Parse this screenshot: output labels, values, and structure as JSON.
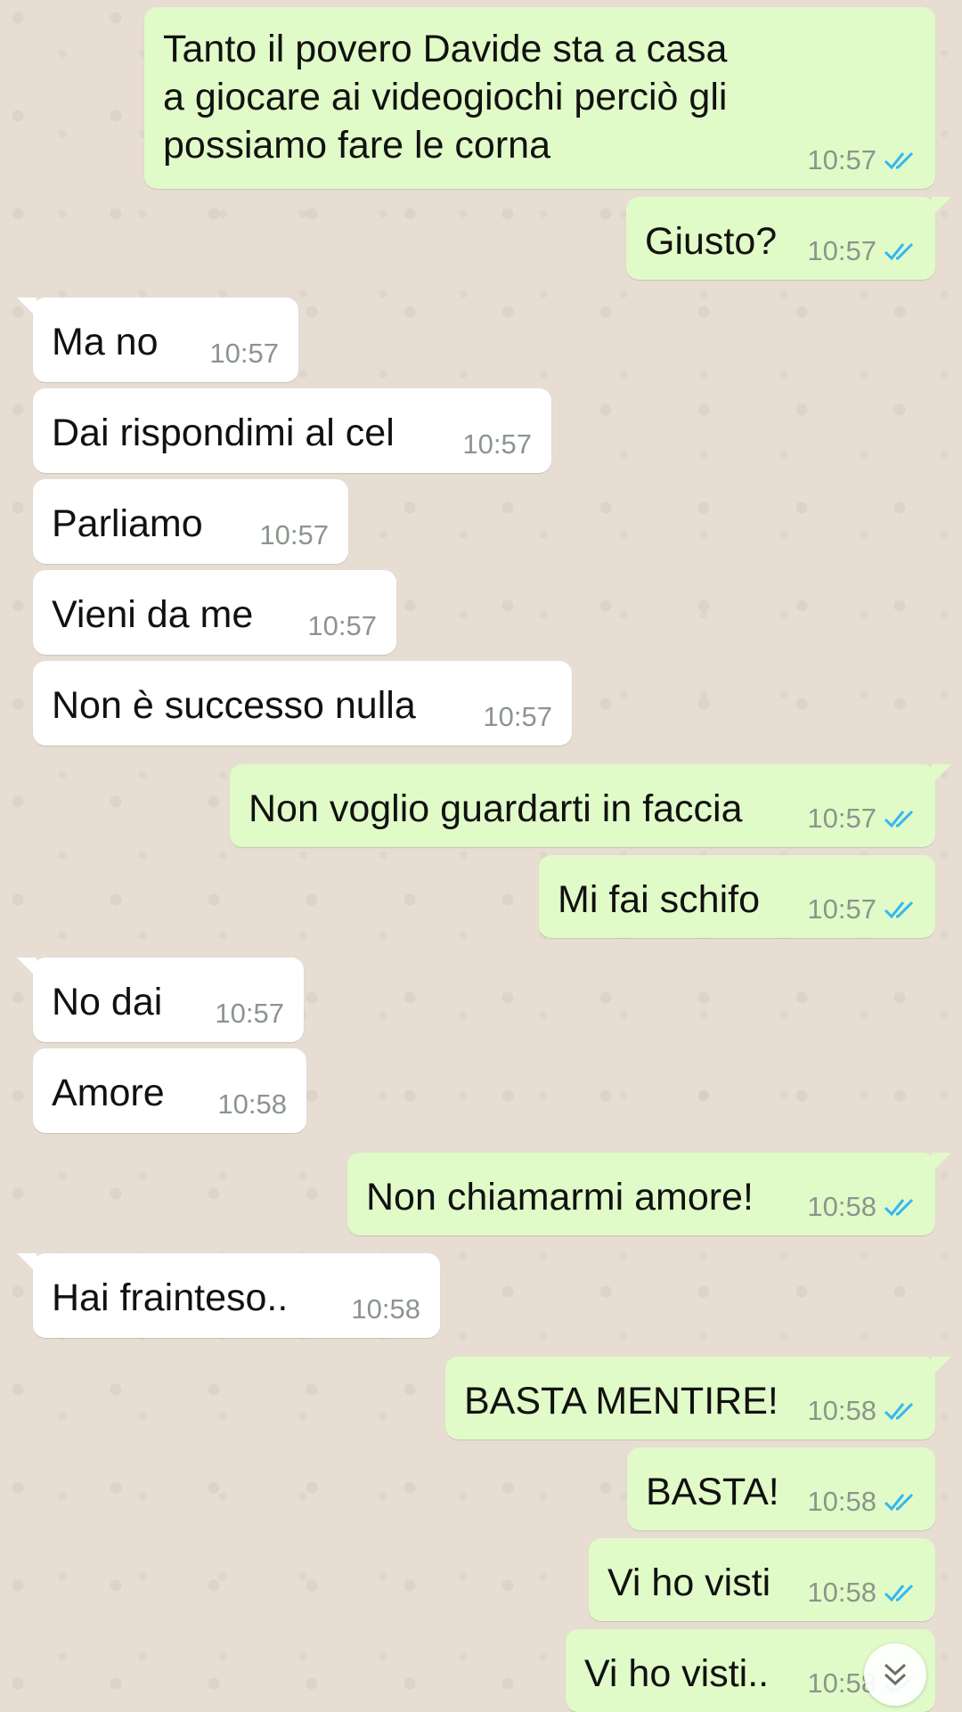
{
  "messages": [
    {
      "dir": "out",
      "text": "Tanto il povero Davide sta a casa\na giocare ai videogiochi perciò gli\npossiamo fare le corna",
      "time": "10:57",
      "status": "read"
    },
    {
      "dir": "out",
      "text": "Giusto?",
      "time": "10:57",
      "status": "read"
    },
    {
      "dir": "in",
      "text": "Ma no",
      "time": "10:57"
    },
    {
      "dir": "in",
      "text": "Dai rispondimi al cel",
      "time": "10:57"
    },
    {
      "dir": "in",
      "text": "Parliamo",
      "time": "10:57"
    },
    {
      "dir": "in",
      "text": "Vieni da me",
      "time": "10:57"
    },
    {
      "dir": "in",
      "text": "Non è successo nulla",
      "time": "10:57"
    },
    {
      "dir": "out",
      "text": "Non voglio guardarti in faccia",
      "time": "10:57",
      "status": "read"
    },
    {
      "dir": "out",
      "text": "Mi fai schifo",
      "time": "10:57",
      "status": "read"
    },
    {
      "dir": "in",
      "text": "No dai",
      "time": "10:57"
    },
    {
      "dir": "in",
      "text": "Amore",
      "time": "10:58"
    },
    {
      "dir": "out",
      "text": "Non chiamarmi amore!",
      "time": "10:58",
      "status": "read"
    },
    {
      "dir": "in",
      "text": "Hai frainteso..",
      "time": "10:58"
    },
    {
      "dir": "out",
      "text": "BASTA MENTIRE!",
      "time": "10:58",
      "status": "read"
    },
    {
      "dir": "out",
      "text": "BASTA!",
      "time": "10:58",
      "status": "read"
    },
    {
      "dir": "out",
      "text": "Vi ho visti",
      "time": "10:58",
      "status": "read"
    },
    {
      "dir": "out",
      "text": "Vi ho visti..",
      "time": "10:58",
      "status": "read"
    }
  ],
  "colors": {
    "outgoing_bubble": "#e1fbc8",
    "incoming_bubble": "#ffffff",
    "read_tick": "#34b7f1",
    "wallpaper": "#e7ddd3"
  },
  "icons": {
    "scroll_down": "double-chevron-down-icon",
    "read_receipt": "double-check-icon"
  }
}
